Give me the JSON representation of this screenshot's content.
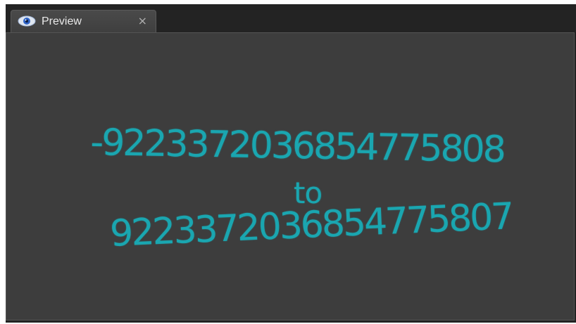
{
  "tab": {
    "label": "Preview",
    "icon": "eye-icon",
    "close_symbol": "×"
  },
  "preview": {
    "line1": "-9223372036854775808",
    "line2": "to",
    "line3": "9223372036854775807"
  },
  "colors": {
    "text": "#1aa6b0",
    "panel": "#3d3d3d",
    "tab": "#464646",
    "frame": "#222222"
  }
}
